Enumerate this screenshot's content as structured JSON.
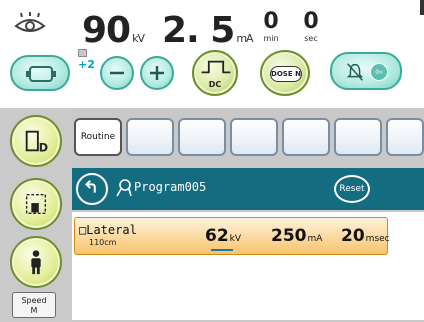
{
  "header": {
    "kv_value": "90",
    "kv_unit": "kV",
    "ma_value": "2. 5",
    "ma_unit": "mA",
    "min_value": "0",
    "min_unit": "min",
    "sec_value": "0",
    "sec_unit": "sec"
  },
  "controls": {
    "step_value": "+2",
    "dc_label": "DC",
    "dose_label": "DOSE N",
    "alarm_label": "0»"
  },
  "tabs": [
    {
      "label": "Routine"
    },
    {
      "label": ""
    },
    {
      "label": ""
    },
    {
      "label": ""
    },
    {
      "label": ""
    },
    {
      "label": ""
    },
    {
      "label": ""
    }
  ],
  "program": {
    "name": "Program005",
    "reset_label": "Reset"
  },
  "exposure_row": {
    "name": "□Lateral",
    "distance": "110cm",
    "kv_value": "62",
    "kv_unit": "kV",
    "ma_value": "250",
    "ma_unit": "mA",
    "time_value": "20",
    "time_unit": "msec"
  },
  "sidebar": {
    "speed_label": "Speed",
    "speed_value": "M"
  },
  "colors": {
    "program_bar": "#146c80",
    "accent_teal": "#00a4c6",
    "row_orange": "#f7c46d"
  }
}
